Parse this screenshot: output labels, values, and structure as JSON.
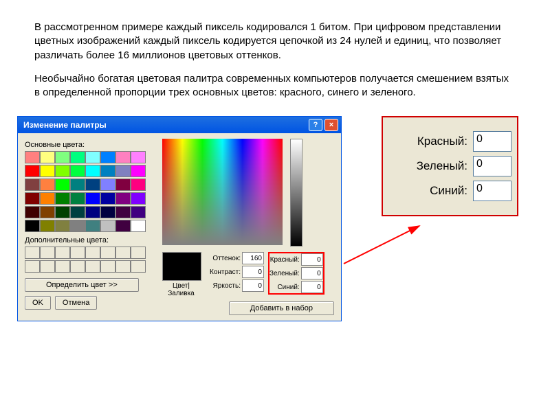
{
  "text": {
    "p1": "В рассмотренном примере каждый пиксель кодировался 1 битом. При цифровом представлении цветных изображений каждый пиксель кодируется цепочкой из 24 нулей и единиц, что позволяет различать более 16 миллионов цветовых оттенков.",
    "p2": "Необычайно богатая цветовая палитра современных компьютеров получается смешением взятых в определенной пропорции трех основных цветов: красного, синего и зеленого."
  },
  "dialog": {
    "title": "Изменение палитры",
    "basic_label": "Основные цвета:",
    "extra_label": "Дополнительные цвета:",
    "define": "Определить цвет >>",
    "ok": "OK",
    "cancel": "Отмена",
    "preview_label": "Цвет|Заливка",
    "hue_label": "Оттенок:",
    "sat_label": "Контраст:",
    "lum_label": "Яркость:",
    "red_label": "Красный:",
    "green_label": "Зеленый:",
    "blue_label": "Синий:",
    "hue": "160",
    "sat": "0",
    "lum": "0",
    "red": "0",
    "green": "0",
    "blue": "0",
    "add": "Добавить в набор"
  },
  "zoom": {
    "red_label": "Красный:",
    "green_label": "Зеленый:",
    "blue_label": "Синий:",
    "red": "0",
    "green": "0",
    "blue": "0"
  },
  "swatches": [
    "#ff8080",
    "#ffff80",
    "#80ff80",
    "#00ff80",
    "#80ffff",
    "#0080ff",
    "#ff80c0",
    "#ff80ff",
    "#ff0000",
    "#ffff00",
    "#80ff00",
    "#00ff40",
    "#00ffff",
    "#0080c0",
    "#8080c0",
    "#ff00ff",
    "#804040",
    "#ff8040",
    "#00ff00",
    "#008080",
    "#004080",
    "#8080ff",
    "#800040",
    "#ff0080",
    "#800000",
    "#ff8000",
    "#008000",
    "#008040",
    "#0000ff",
    "#0000a0",
    "#800080",
    "#8000ff",
    "#400000",
    "#804000",
    "#004000",
    "#004040",
    "#000080",
    "#000040",
    "#400040",
    "#400080",
    "#000000",
    "#808000",
    "#808040",
    "#808080",
    "#408080",
    "#c0c0c0",
    "#400040",
    "#ffffff"
  ]
}
